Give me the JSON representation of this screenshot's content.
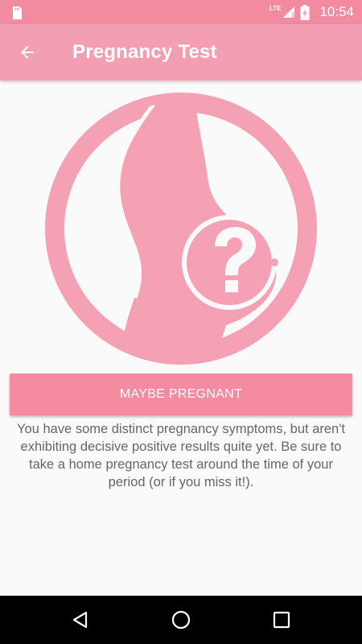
{
  "status_bar": {
    "network": "LTE",
    "time": "10:54",
    "icons": [
      "sd-card-icon",
      "signal-icon",
      "battery-icon"
    ]
  },
  "app_bar": {
    "title": "Pregnancy Test",
    "back_icon": "arrow-left-icon"
  },
  "hero": {
    "icon": "pregnant-belly-question-icon"
  },
  "result": {
    "button_label": "MAYBE PREGNANT",
    "description": "You have some distinct pregnancy symptoms, but aren't exhibiting decisive positive results quite yet. Be sure to take a home pregnancy test around the time of your period (or if you miss it!)."
  },
  "nav_bar": {
    "icons": [
      "back-triangle-icon",
      "home-circle-icon",
      "recents-square-icon"
    ]
  },
  "colors": {
    "status_bar": "#f08ba0",
    "app_bar": "#f29fb1",
    "accent": "#f48ba0",
    "hero": "#f4a2b3",
    "background": "#fafafa",
    "text": "#666666"
  }
}
